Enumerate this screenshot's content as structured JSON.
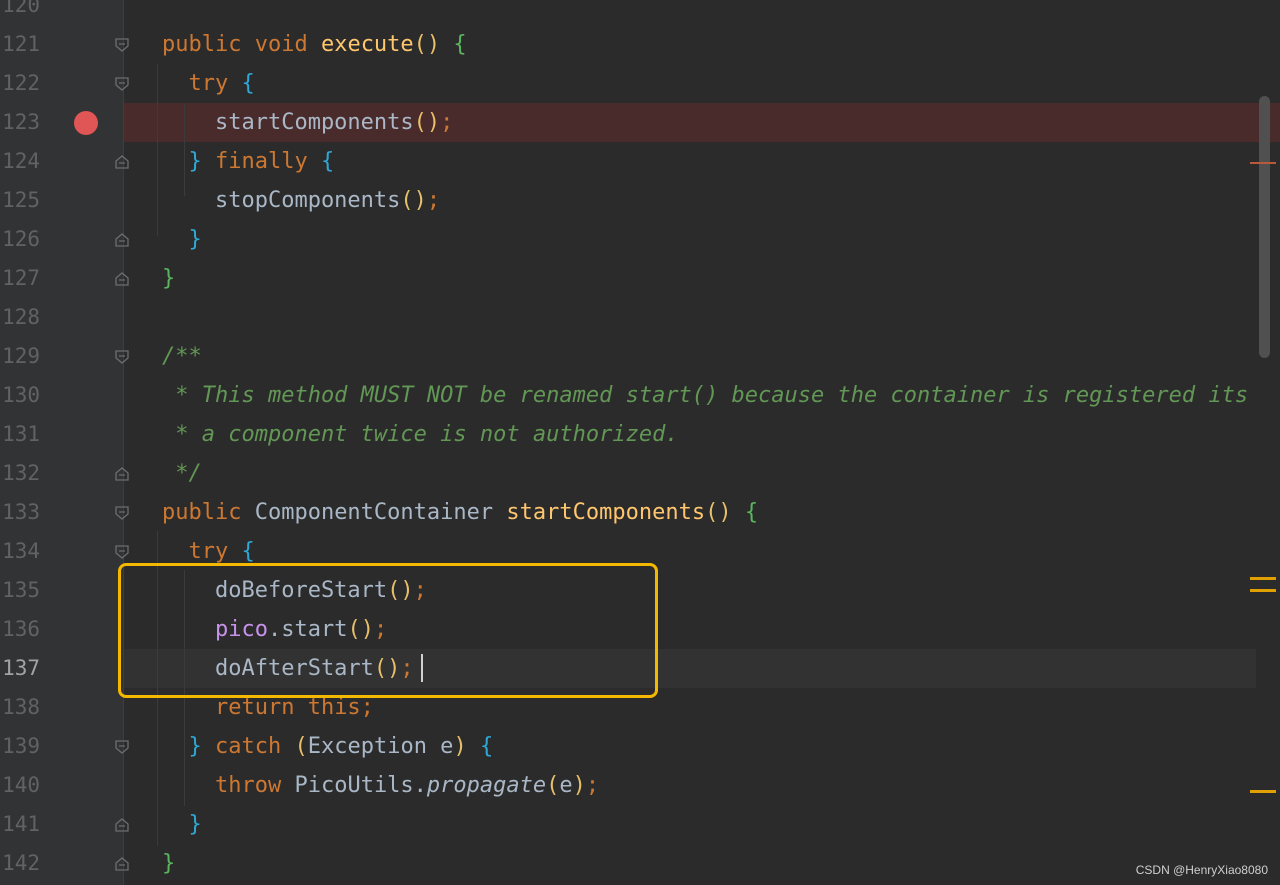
{
  "lines": [
    {
      "num": "120",
      "tokens": []
    },
    {
      "num": "121",
      "tokens": [
        [
          "kw",
          "public "
        ],
        [
          "kw",
          "void "
        ],
        [
          "fn",
          "execute"
        ],
        [
          "paren",
          "() "
        ],
        [
          "brace-g",
          "{"
        ]
      ]
    },
    {
      "num": "122",
      "tokens": [
        [
          "plain",
          "  "
        ],
        [
          "kw",
          "try "
        ],
        [
          "brace-b",
          "{"
        ]
      ]
    },
    {
      "num": "123",
      "tokens": [
        [
          "plain",
          "    startComponents"
        ],
        [
          "paren",
          "()"
        ],
        [
          "kw",
          ";"
        ]
      ]
    },
    {
      "num": "124",
      "tokens": [
        [
          "plain",
          "  "
        ],
        [
          "brace-b",
          "} "
        ],
        [
          "kw",
          "finally "
        ],
        [
          "brace-b",
          "{"
        ]
      ]
    },
    {
      "num": "125",
      "tokens": [
        [
          "plain",
          "    stopComponents"
        ],
        [
          "paren",
          "()"
        ],
        [
          "kw",
          ";"
        ]
      ]
    },
    {
      "num": "126",
      "tokens": [
        [
          "plain",
          "  "
        ],
        [
          "brace-b",
          "}"
        ]
      ]
    },
    {
      "num": "127",
      "tokens": [
        [
          "brace-g",
          "}"
        ]
      ]
    },
    {
      "num": "128",
      "tokens": []
    },
    {
      "num": "129",
      "tokens": [
        [
          "comment",
          "/**"
        ]
      ]
    },
    {
      "num": "130",
      "tokens": [
        [
          "comment",
          " * This method MUST NOT be renamed start() because the container is registered its"
        ]
      ]
    },
    {
      "num": "131",
      "tokens": [
        [
          "comment",
          " * a component twice is not authorized."
        ]
      ]
    },
    {
      "num": "132",
      "tokens": [
        [
          "comment",
          " */"
        ]
      ]
    },
    {
      "num": "133",
      "tokens": [
        [
          "kw",
          "public "
        ],
        [
          "plain",
          "ComponentContainer "
        ],
        [
          "fn",
          "startComponents"
        ],
        [
          "paren",
          "() "
        ],
        [
          "brace-g",
          "{"
        ]
      ]
    },
    {
      "num": "134",
      "tokens": [
        [
          "plain",
          "  "
        ],
        [
          "kw",
          "try "
        ],
        [
          "brace-b",
          "{"
        ]
      ]
    },
    {
      "num": "135",
      "tokens": [
        [
          "plain",
          "    doBeforeStart"
        ],
        [
          "paren",
          "()"
        ],
        [
          "kw",
          ";"
        ]
      ]
    },
    {
      "num": "136",
      "tokens": [
        [
          "plain",
          "    "
        ],
        [
          "field",
          "pico"
        ],
        [
          "plain",
          ".start"
        ],
        [
          "paren",
          "()"
        ],
        [
          "kw",
          ";"
        ]
      ]
    },
    {
      "num": "137",
      "tokens": [
        [
          "plain",
          "    doAfterStart"
        ],
        [
          "paren",
          "()"
        ],
        [
          "kw",
          ";"
        ]
      ]
    },
    {
      "num": "138",
      "tokens": [
        [
          "plain",
          "    "
        ],
        [
          "kw",
          "return this;"
        ]
      ]
    },
    {
      "num": "139",
      "tokens": [
        [
          "plain",
          "  "
        ],
        [
          "brace-b",
          "} "
        ],
        [
          "kw",
          "catch "
        ],
        [
          "paren",
          "("
        ],
        [
          "plain",
          "Exception e"
        ],
        [
          "paren",
          ") "
        ],
        [
          "brace-b",
          "{"
        ]
      ]
    },
    {
      "num": "140",
      "tokens": [
        [
          "plain",
          "    "
        ],
        [
          "kw",
          "throw "
        ],
        [
          "plain",
          "PicoUtils."
        ],
        [
          "italic-fn",
          "propagate"
        ],
        [
          "paren",
          "("
        ],
        [
          "plain",
          "e"
        ],
        [
          "paren",
          ")"
        ],
        [
          "kw",
          ";"
        ]
      ]
    },
    {
      "num": "141",
      "tokens": [
        [
          "plain",
          "  "
        ],
        [
          "brace-b",
          "}"
        ]
      ]
    },
    {
      "num": "142",
      "tokens": [
        [
          "brace-g",
          "}"
        ]
      ]
    }
  ],
  "breakpoint_line": "123",
  "current_line": "137",
  "watermark": "CSDN @HenryXiao8080",
  "colors": {
    "background": "#2b2b2b",
    "keyword": "#cc7832",
    "function": "#ffc66d",
    "comment": "#629755",
    "highlight_box": "#f5b800",
    "breakpoint": "#e05555"
  }
}
